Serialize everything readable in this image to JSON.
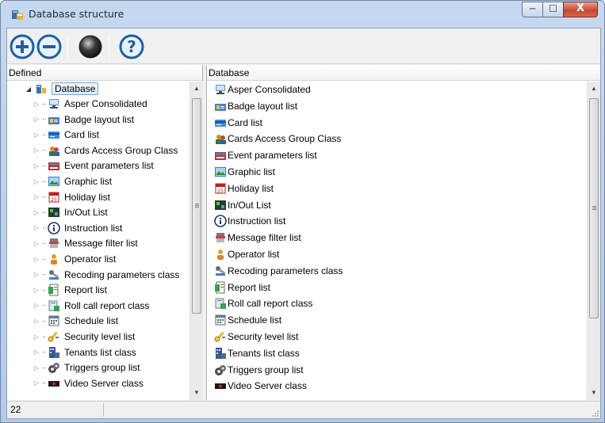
{
  "window": {
    "title": "Database structure",
    "title_icon": "database-structure-icon",
    "controls": {
      "minimize": "─",
      "maximize": "☐",
      "close": "X"
    }
  },
  "toolbar": {
    "items": [
      {
        "name": "expand-all-icon",
        "color": "#1b5fa8"
      },
      {
        "name": "collapse-all-icon",
        "color": "#1b5fa8"
      },
      {
        "name": "record-icon",
        "color": "#3a3a3a"
      },
      {
        "name": "help-icon",
        "color": "#1b5fa8"
      }
    ]
  },
  "left_pane": {
    "header": "Defined",
    "root": {
      "label": "Database",
      "icon": "database-icon"
    },
    "items": [
      {
        "label": "Asper Consolidated",
        "icon": "computer-icon"
      },
      {
        "label": "Badge layout list",
        "icon": "badge-layout-icon"
      },
      {
        "label": "Card list",
        "icon": "card-icon"
      },
      {
        "label": "Cards Access Group Class",
        "icon": "access-group-icon"
      },
      {
        "label": "Event parameters list",
        "icon": "event-parameters-icon"
      },
      {
        "label": "Graphic list",
        "icon": "graphic-icon"
      },
      {
        "label": "Holiday list",
        "icon": "calendar-icon"
      },
      {
        "label": "In/Out List",
        "icon": "in-out-icon"
      },
      {
        "label": "Instruction list",
        "icon": "info-icon"
      },
      {
        "label": "Message filter list",
        "icon": "message-filter-icon"
      },
      {
        "label": "Operator list",
        "icon": "operator-icon"
      },
      {
        "label": "Recoding parameters class",
        "icon": "recording-parameters-icon"
      },
      {
        "label": "Report list",
        "icon": "report-icon"
      },
      {
        "label": "Roll call report class",
        "icon": "roll-call-icon"
      },
      {
        "label": "Schedule list",
        "icon": "schedule-icon"
      },
      {
        "label": "Security level list",
        "icon": "security-level-icon"
      },
      {
        "label": "Tenants list class",
        "icon": "tenants-icon"
      },
      {
        "label": "Triggers group list",
        "icon": "triggers-icon"
      },
      {
        "label": "Video Server class",
        "icon": "video-server-icon"
      }
    ]
  },
  "right_pane": {
    "header": "Database",
    "items": [
      {
        "label": "Asper Consolidated",
        "icon": "computer-icon"
      },
      {
        "label": "Badge layout list",
        "icon": "badge-layout-icon"
      },
      {
        "label": "Card list",
        "icon": "card-icon"
      },
      {
        "label": "Cards Access Group Class",
        "icon": "access-group-icon"
      },
      {
        "label": "Event parameters list",
        "icon": "event-parameters-icon"
      },
      {
        "label": "Graphic list",
        "icon": "graphic-icon"
      },
      {
        "label": "Holiday list",
        "icon": "calendar-icon"
      },
      {
        "label": "In/Out List",
        "icon": "in-out-icon"
      },
      {
        "label": "Instruction list",
        "icon": "info-icon"
      },
      {
        "label": "Message filter list",
        "icon": "message-filter-icon"
      },
      {
        "label": "Operator list",
        "icon": "operator-icon"
      },
      {
        "label": "Recoding parameters class",
        "icon": "recording-parameters-icon"
      },
      {
        "label": "Report list",
        "icon": "report-icon"
      },
      {
        "label": "Roll call report class",
        "icon": "roll-call-icon"
      },
      {
        "label": "Schedule list",
        "icon": "schedule-icon"
      },
      {
        "label": "Security level list",
        "icon": "security-level-icon"
      },
      {
        "label": "Tenants list class",
        "icon": "tenants-icon"
      },
      {
        "label": "Triggers group list",
        "icon": "triggers-icon"
      },
      {
        "label": "Video Server class",
        "icon": "video-server-icon"
      }
    ]
  },
  "statusbar": {
    "count": "22"
  },
  "colors": {
    "title_bar": "#c5d8ee",
    "selection_border": "#7da2ce",
    "close_button": "#c44a32"
  }
}
